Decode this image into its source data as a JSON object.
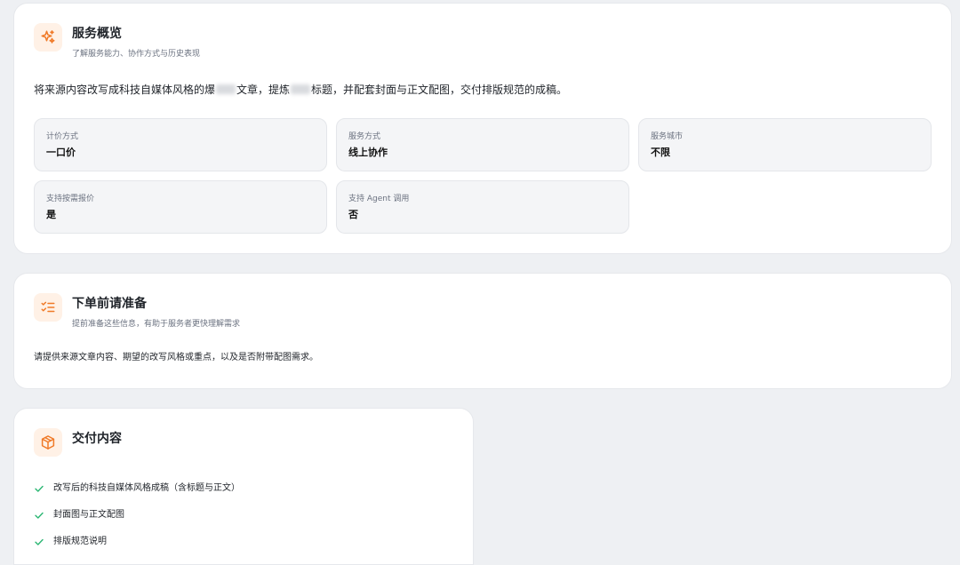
{
  "overview": {
    "title": "服务概览",
    "subtitle": "了解服务能力、协作方式与历史表现",
    "desc_part1": "将来源内容改写成科技自媒体风格的爆",
    "desc_part2": "文章，提炼",
    "desc_part3": "标题，并配套封面与正文配图，交付排版规范的成稿。",
    "fields": [
      {
        "label": "计价方式",
        "value": "一口价"
      },
      {
        "label": "服务方式",
        "value": "线上协作"
      },
      {
        "label": "服务城市",
        "value": "不限"
      },
      {
        "label": "支持按需报价",
        "value": "是"
      },
      {
        "label": "支持 Agent 调用",
        "value": "否"
      }
    ]
  },
  "prepare": {
    "title": "下单前请准备",
    "subtitle": "提前准备这些信息，有助于服务者更快理解需求",
    "text": "请提供来源文章内容、期望的改写风格或重点，以及是否附带配图需求。"
  },
  "deliver": {
    "title": "交付内容",
    "items": [
      "改写后的科技自媒体风格成稿（含标题与正文）",
      "封面图与正文配图",
      "排版规范说明"
    ]
  },
  "colors": {
    "accent": "#f07a28",
    "icon_bg": "#fff1e6",
    "check": "#2bb673"
  }
}
